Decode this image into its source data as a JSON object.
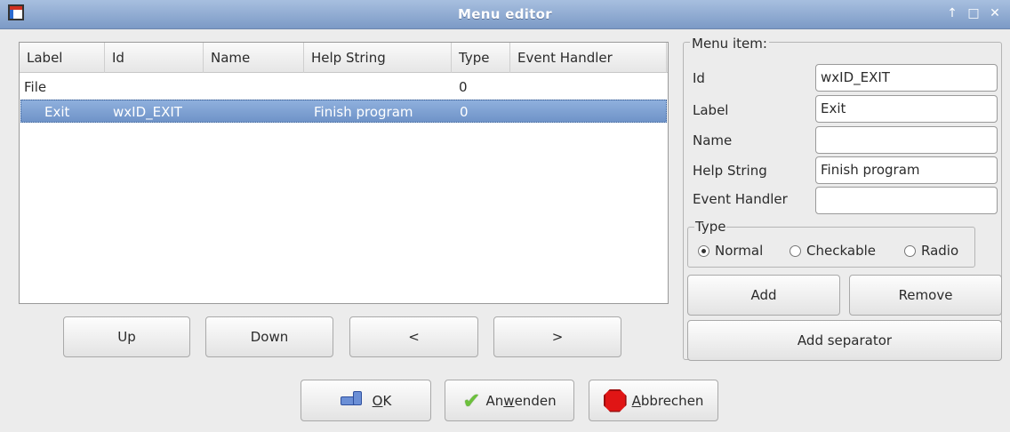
{
  "window": {
    "title": "Menu editor"
  },
  "list": {
    "columns": [
      "Label",
      "Id",
      "Name",
      "Help String",
      "Type",
      "Event Handler"
    ],
    "rows": [
      {
        "label": "File",
        "id": "",
        "name": "",
        "help": "",
        "type": "0",
        "handler": "",
        "selected": false
      },
      {
        "label": "Exit",
        "id": "wxID_EXIT",
        "name": "",
        "help": "Finish program",
        "type": "0",
        "handler": "",
        "selected": true
      }
    ]
  },
  "nav_buttons": {
    "up": "Up",
    "down": "Down",
    "left": "<",
    "right": ">"
  },
  "menu_item": {
    "group_title": "Menu item:",
    "id_label": "Id",
    "id_value": "wxID_EXIT",
    "label_label": "Label",
    "label_value": "Exit",
    "name_label": "Name",
    "name_value": "",
    "help_label": "Help String",
    "help_value": "Finish program",
    "handler_label": "Event Handler",
    "handler_value": "",
    "type_title": "Type",
    "type_options": [
      "Normal",
      "Checkable",
      "Radio"
    ],
    "type_selected": "Normal",
    "add": "Add",
    "remove": "Remove",
    "add_separator": "Add separator"
  },
  "dialog_buttons": {
    "ok_prefix": "",
    "ok_mnemonic": "O",
    "ok_rest": "K",
    "apply_prefix": "An",
    "apply_mnemonic": "w",
    "apply_rest": "enden",
    "cancel_prefix": "",
    "cancel_mnemonic": "A",
    "cancel_rest": "bbrechen"
  }
}
